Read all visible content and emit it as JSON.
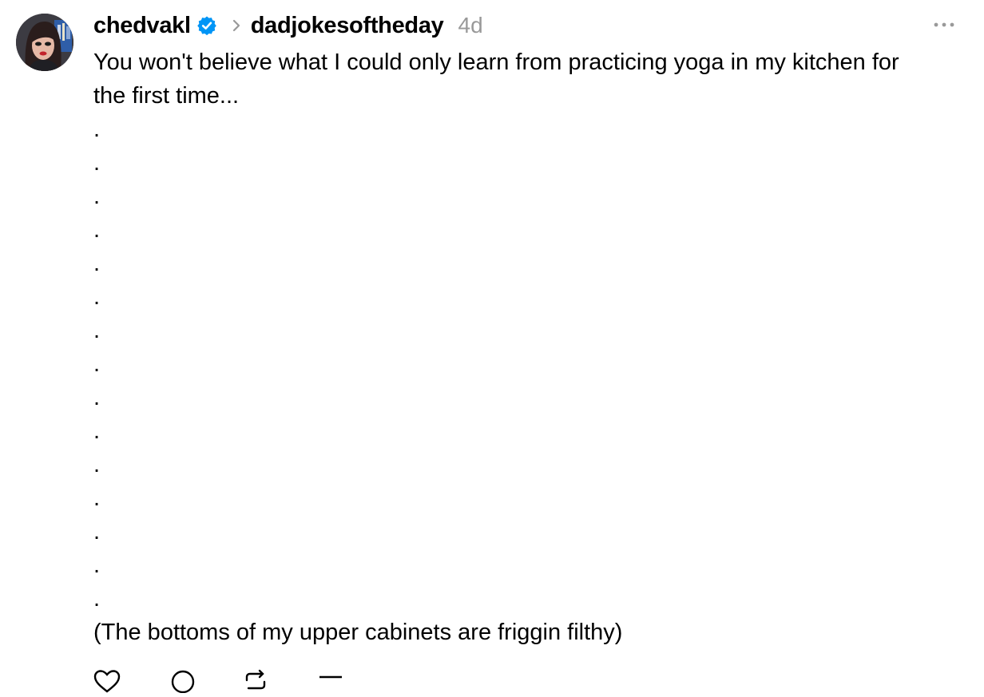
{
  "post": {
    "author": "chedvakl",
    "verified_icon": "verified-badge-icon",
    "separator_icon": "chevron-right-icon",
    "community": "dadjokesoftheday",
    "timestamp": "4d",
    "more_icon": "more-options-icon",
    "lines": [
      "You won't believe what I could only learn from practicing yoga in my kitchen for",
      "the first time...",
      ".",
      ".",
      ".",
      ".",
      ".",
      ".",
      ".",
      ".",
      ".",
      ".",
      ".",
      ".",
      ".",
      ".",
      ".",
      "(The bottoms of my upper cabinets are friggin filthy)"
    ],
    "action_icons": [
      "like-icon",
      "comment-icon",
      "repost-icon",
      "share-icon"
    ]
  },
  "colors": {
    "text": "#000000",
    "muted": "#999999",
    "verified": "#0095f6",
    "background": "#ffffff"
  }
}
